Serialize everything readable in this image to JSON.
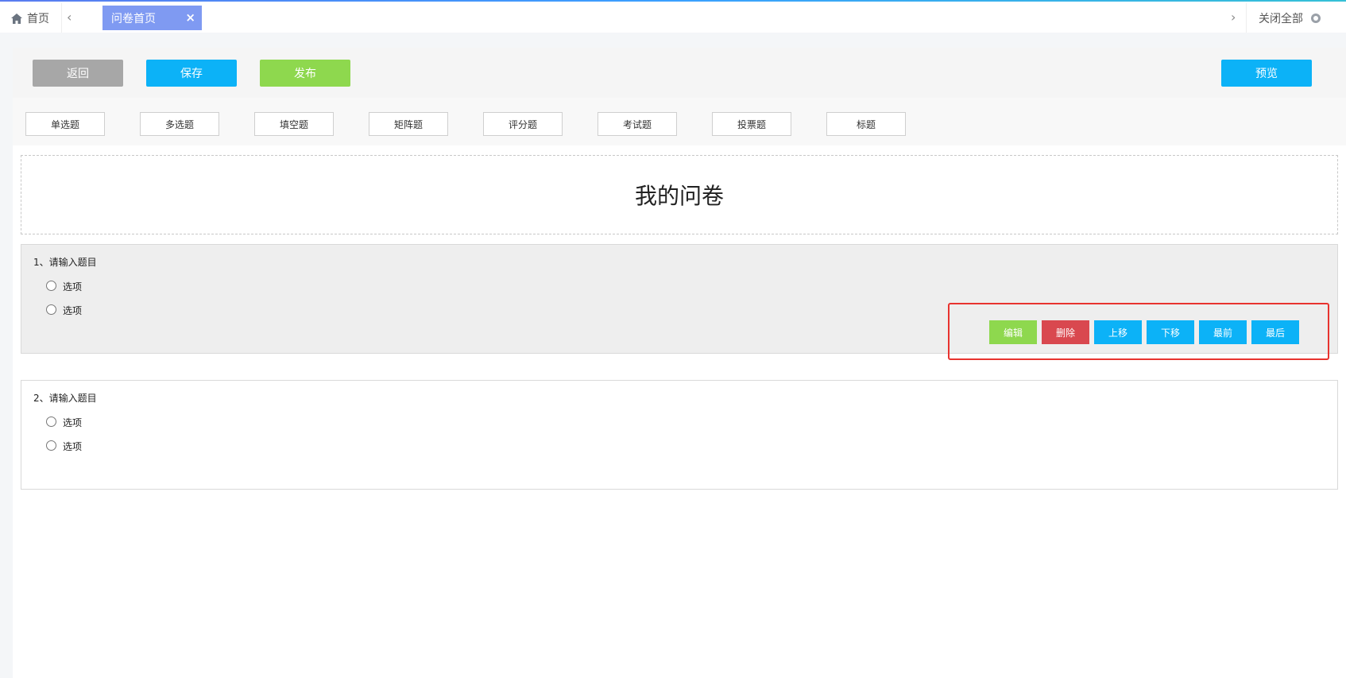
{
  "tabs": {
    "home_label": "首页",
    "active_label": "问卷首页",
    "close_icon": "×",
    "prev_icon": "‹",
    "next_icon": "›",
    "close_all_label": "关闭全部"
  },
  "toolbar": {
    "back_label": "返回",
    "save_label": "保存",
    "publish_label": "发布",
    "preview_label": "预览"
  },
  "question_types": [
    "单选题",
    "多选题",
    "填空题",
    "矩阵题",
    "评分题",
    "考试题",
    "投票题",
    "标题"
  ],
  "survey": {
    "title": "我的问卷",
    "questions": [
      {
        "title": "1、请输入题目",
        "options": [
          "选项",
          "选项"
        ]
      },
      {
        "title": "2、请输入题目",
        "options": [
          "选项",
          "选项"
        ]
      }
    ]
  },
  "question_actions": {
    "edit_label": "编辑",
    "delete_label": "删除",
    "move_up_label": "上移",
    "move_down_label": "下移",
    "move_first_label": "最前",
    "move_last_label": "最后"
  },
  "colors": {
    "gray": "#a7a7a7",
    "blue": "#0cb2f7",
    "green": "#8ed84e",
    "red": "#d9484f",
    "tab_active": "#7f9af2"
  }
}
